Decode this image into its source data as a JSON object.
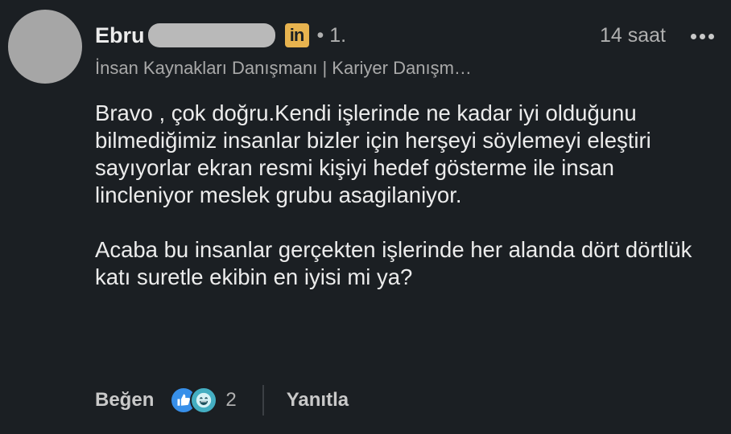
{
  "comment": {
    "author_name": "Ebru",
    "connection_degree": "• 1.",
    "linkedin_badge": "in",
    "timestamp": "14 saat",
    "headline": "İnsan Kaynakları Danışmanı | Kariyer Danışm…",
    "body_paragraphs": [
      "Bravo , çok doğru.Kendi işlerinde ne kadar iyi olduğunu bilmediğimiz insanlar bizler için herşeyi söylemeyi eleştiri sayıyorlar ekran resmi kişiyi hedef gösterme ile insan lincleniyor meslek grubu asagilaniyor.",
      "Acaba bu insanlar gerçekten işlerinde her alanda dört dörtlük katı suretle ekibin en iyisi mi ya?"
    ]
  },
  "actions": {
    "like_label": "Beğen",
    "reaction_count": "2",
    "reply_label": "Yanıtla",
    "reaction_icons": [
      "like-icon",
      "funny-icon"
    ]
  },
  "colors": {
    "background": "#1b1f23",
    "text": "#ececec",
    "muted": "#b0b0b0",
    "linkedin_badge": "#e7b34f",
    "like_reaction": "#378fe9",
    "funny_reaction": "#44aec2"
  }
}
